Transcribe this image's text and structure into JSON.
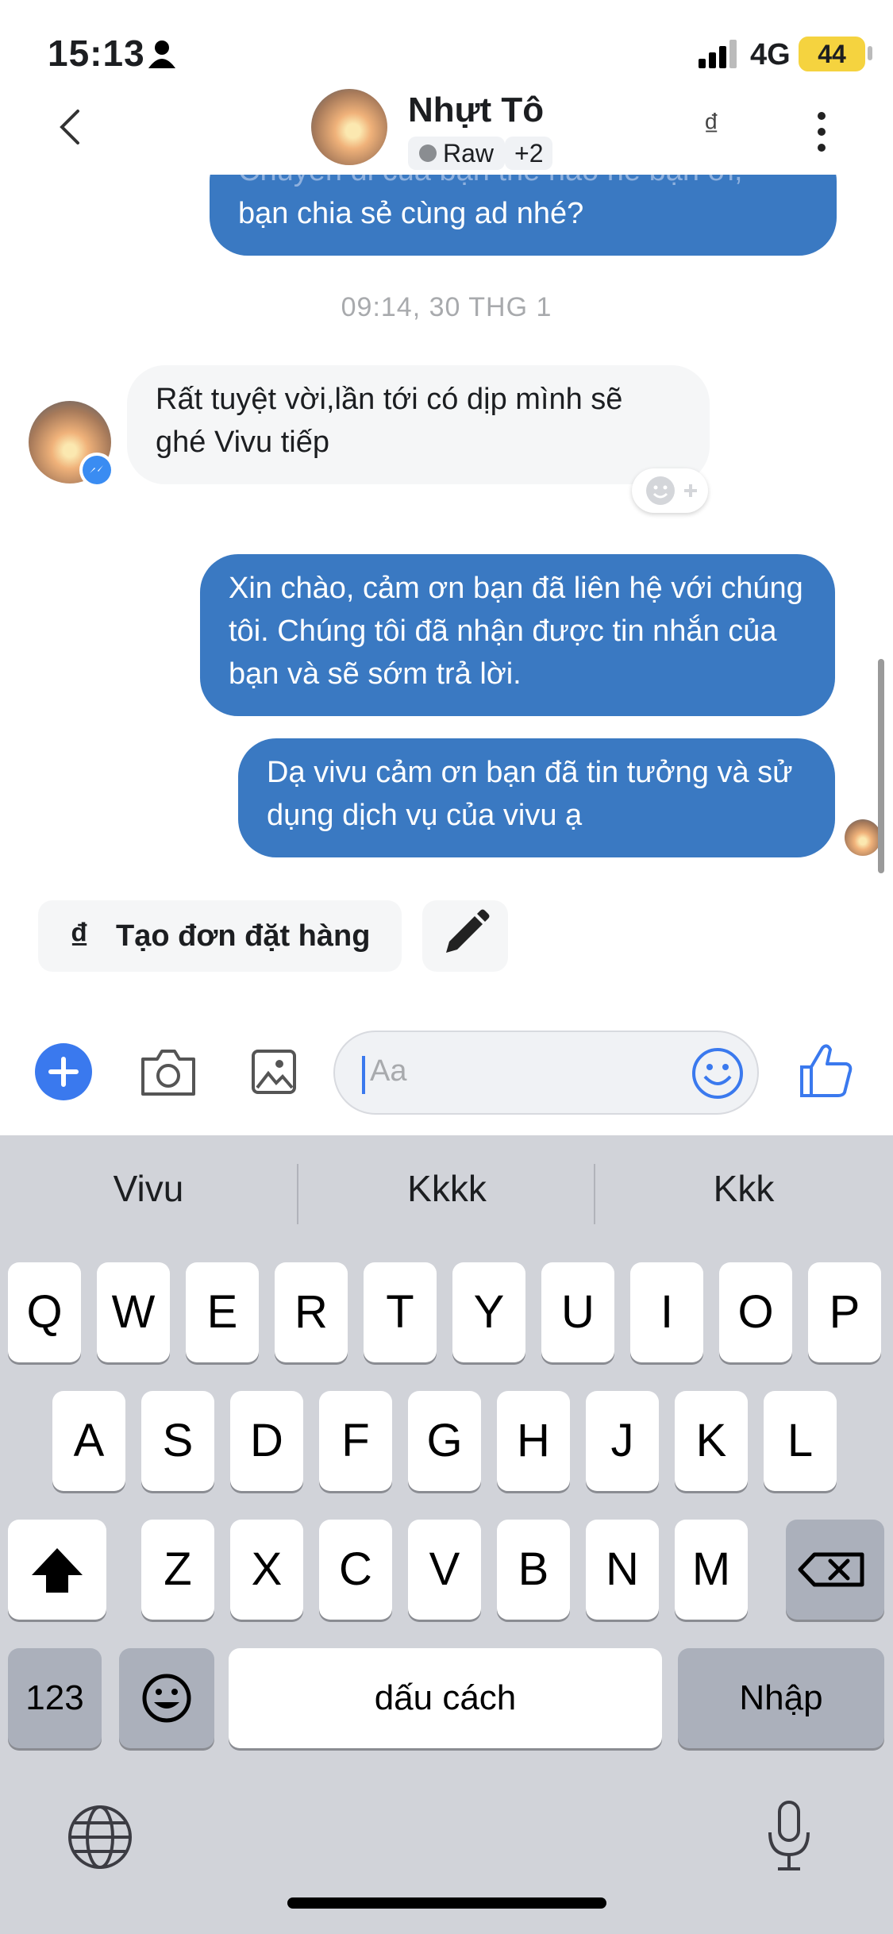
{
  "status_bar": {
    "time": "15:13",
    "network": "4G",
    "battery": "44"
  },
  "header": {
    "contact_name": "Nhựt Tô",
    "tag_label": "Raw",
    "tag_more": "+2",
    "currency_symbol": "₫"
  },
  "messages": {
    "partial_top_line1": "Chuyến đi của bạn thế nào nè bạn ơi,",
    "partial_top_line2": "bạn chia sẻ cùng ad nhé?",
    "timestamp": "09:14, 30 THG 1",
    "incoming_text": "Rất tuyệt vời,lần tới có dịp mình sẽ ghé Vivu tiếp",
    "auto_reply_text": "Xin chào, cảm ơn bạn đã liên hệ với chúng tôi. Chúng tôi đã nhận được tin nhắn của bạn và sẽ sớm trả lời.",
    "thanks_text": "Dạ vivu cảm ơn bạn đã tin tưởng và sử dụng dịch vụ của vivu ạ"
  },
  "quick_actions": {
    "order_icon": "₫",
    "order_label": "Tạo đơn đặt hàng"
  },
  "composer": {
    "placeholder": "Aa"
  },
  "keyboard": {
    "suggestions": [
      "Vivu",
      "Kkkk",
      "Kkk"
    ],
    "row1": [
      "Q",
      "W",
      "E",
      "R",
      "T",
      "Y",
      "U",
      "I",
      "O",
      "P"
    ],
    "row2": [
      "A",
      "S",
      "D",
      "F",
      "G",
      "H",
      "J",
      "K",
      "L"
    ],
    "row3": [
      "Z",
      "X",
      "C",
      "V",
      "B",
      "N",
      "M"
    ],
    "numbers_key": "123",
    "space_key": "dấu cách",
    "return_key": "Nhập"
  },
  "icons": [
    "person-icon",
    "signal-icon",
    "back-icon",
    "more-icon",
    "messenger-icon",
    "add-reaction-icon",
    "pencil-icon",
    "plus-icon",
    "camera-icon",
    "image-icon",
    "emoji-icon",
    "thumbs-up-icon",
    "shift-icon",
    "delete-icon",
    "globe-icon",
    "mic-icon"
  ]
}
